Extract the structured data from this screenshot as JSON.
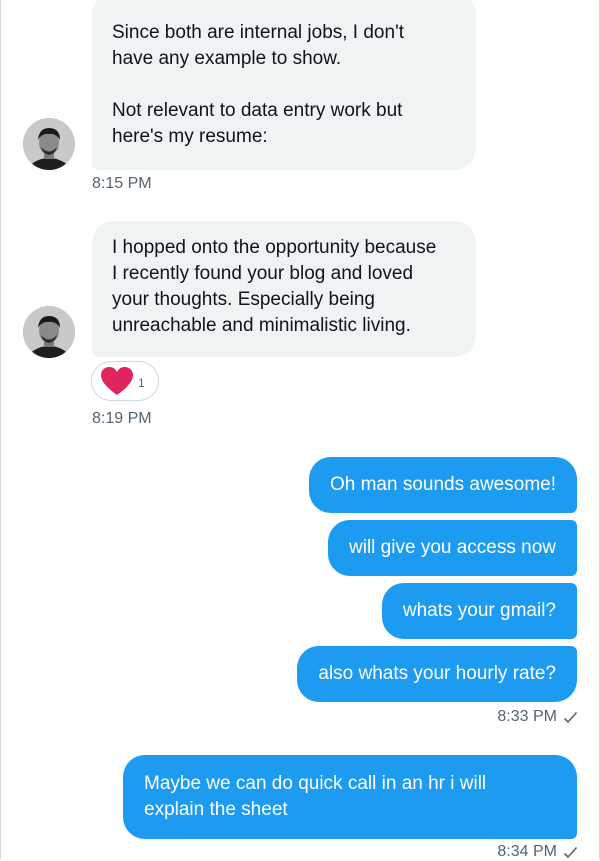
{
  "conversation": {
    "incoming": [
      {
        "lines": [
          "Since both are internal jobs, I don't",
          "have any example to show.",
          "",
          "Not relevant to data entry work but",
          "here's my resume:"
        ],
        "time": "8:15 PM"
      },
      {
        "lines": [
          "I hopped onto the opportunity because",
          "I recently found your blog and loved",
          "your thoughts. Especially being",
          "unreachable and minimalistic living."
        ],
        "reaction": {
          "icon": "heart-icon",
          "count": "1",
          "color": "#e0245e"
        },
        "time": "8:19 PM"
      }
    ],
    "outgoing": [
      {
        "text": "Oh man sounds awesome!"
      },
      {
        "text": "will give you access now"
      },
      {
        "text": "whats your gmail?"
      },
      {
        "text": "also whats your hourly rate?"
      }
    ],
    "outgoing_time_1": "8:33 PM",
    "outgoing_last": {
      "lines": [
        "Maybe we can do quick call in an hr i will",
        "explain the sheet"
      ]
    },
    "outgoing_time_2": "8:34 PM"
  },
  "colors": {
    "outgoing_bubble": "#1d9bf0",
    "incoming_bubble": "#eff3f4",
    "timestamp": "#536471"
  }
}
